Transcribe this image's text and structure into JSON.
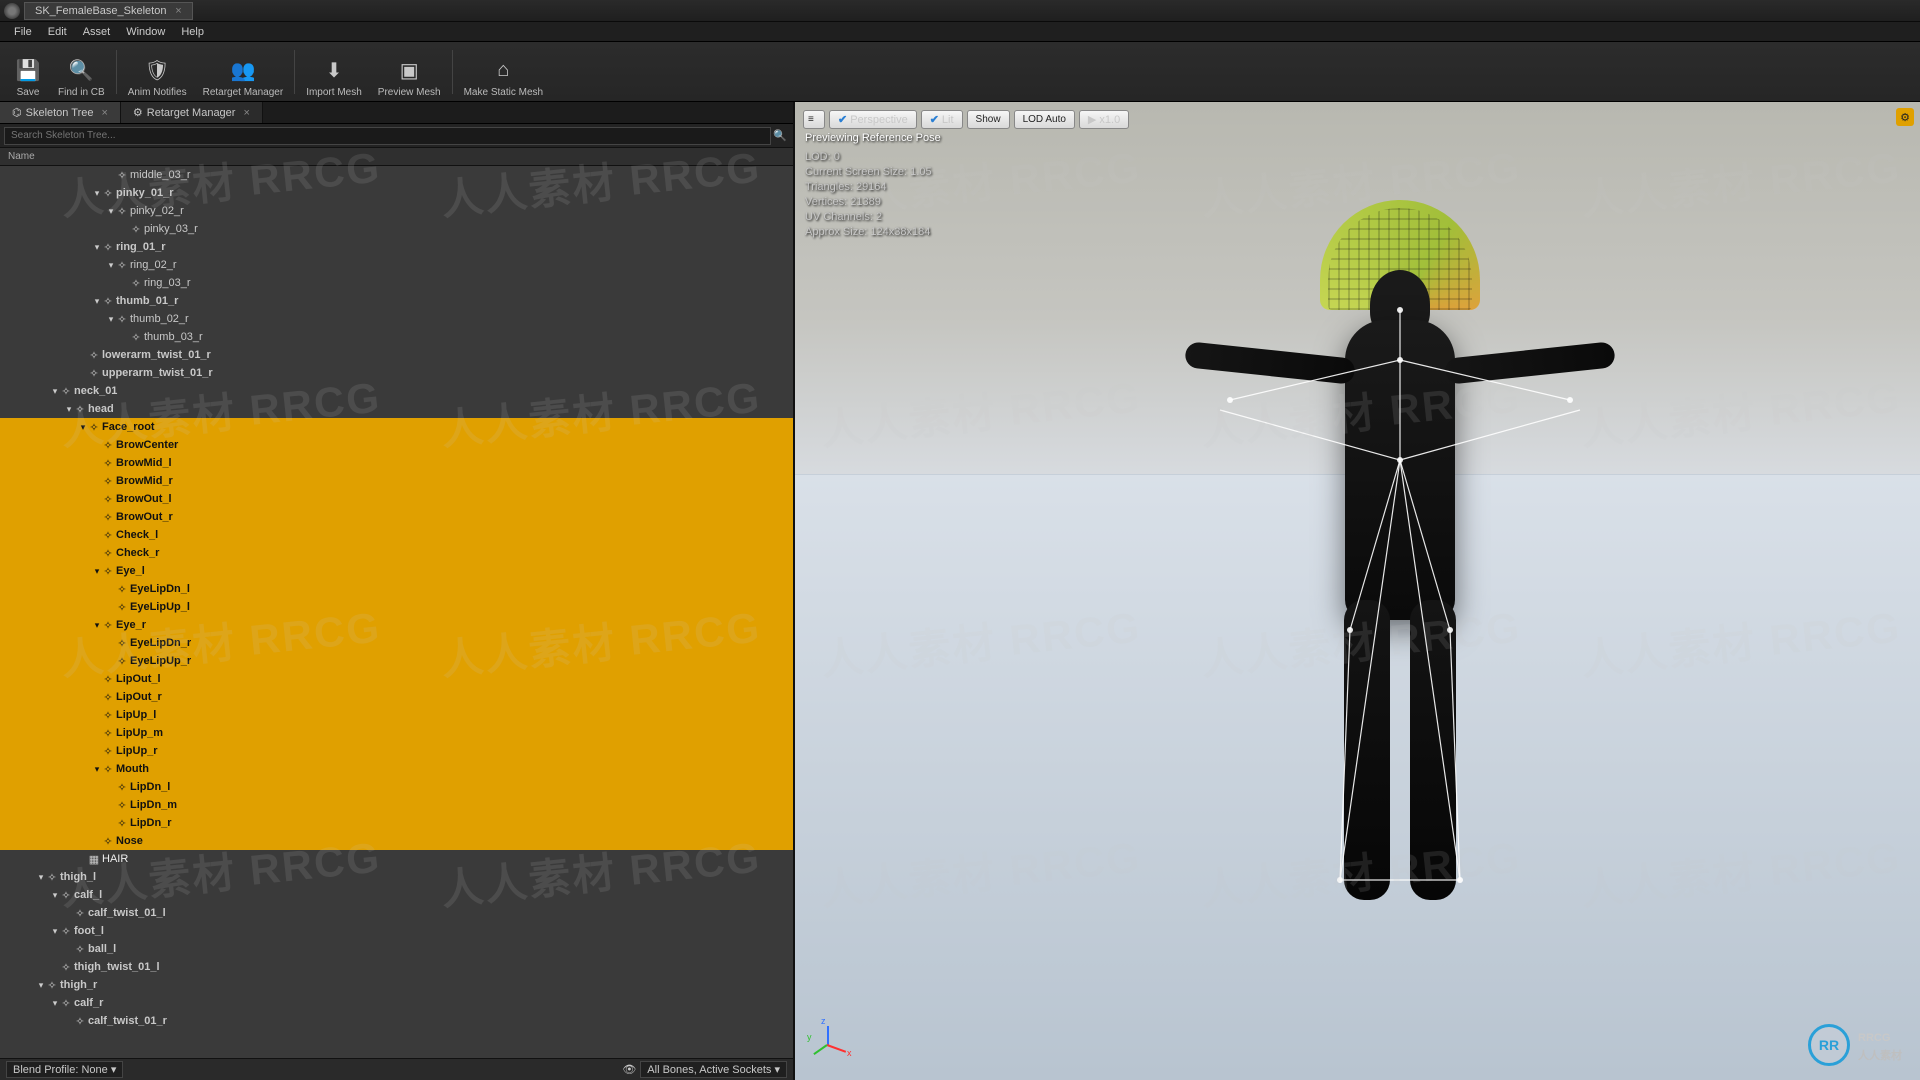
{
  "title_tab": "SK_FemaleBase_Skeleton",
  "menu": [
    "File",
    "Edit",
    "Asset",
    "Window",
    "Help"
  ],
  "toolbar": [
    {
      "icon": "💾",
      "label": "Save"
    },
    {
      "icon": "🔍",
      "label": "Find in CB"
    },
    {
      "sep": true
    },
    {
      "icon": "🛡",
      "label": "Anim Notifies"
    },
    {
      "icon": "👥",
      "label": "Retarget Manager"
    },
    {
      "sep": true
    },
    {
      "icon": "⬇",
      "label": "Import Mesh"
    },
    {
      "icon": "▣",
      "label": "Preview Mesh"
    },
    {
      "sep": true
    },
    {
      "icon": "⌂",
      "label": "Make Static Mesh"
    }
  ],
  "panel_tabs": [
    {
      "icon": "⌬",
      "label": "Skeleton Tree",
      "active": true
    },
    {
      "icon": "⚙",
      "label": "Retarget Manager",
      "active": false
    }
  ],
  "search_placeholder": "Search Skeleton Tree...",
  "col_header": "Name",
  "tree": [
    {
      "d": 7,
      "n": "middle_03_r",
      "a": ""
    },
    {
      "d": 6,
      "n": "pinky_01_r",
      "a": "▾",
      "bold": true
    },
    {
      "d": 7,
      "n": "pinky_02_r",
      "a": "▾"
    },
    {
      "d": 8,
      "n": "pinky_03_r",
      "a": ""
    },
    {
      "d": 6,
      "n": "ring_01_r",
      "a": "▾",
      "bold": true
    },
    {
      "d": 7,
      "n": "ring_02_r",
      "a": "▾"
    },
    {
      "d": 8,
      "n": "ring_03_r",
      "a": ""
    },
    {
      "d": 6,
      "n": "thumb_01_r",
      "a": "▾",
      "bold": true
    },
    {
      "d": 7,
      "n": "thumb_02_r",
      "a": "▾"
    },
    {
      "d": 8,
      "n": "thumb_03_r",
      "a": ""
    },
    {
      "d": 5,
      "n": "lowerarm_twist_01_r",
      "a": "",
      "bold": true
    },
    {
      "d": 5,
      "n": "upperarm_twist_01_r",
      "a": "",
      "bold": true
    },
    {
      "d": 3,
      "n": "neck_01",
      "a": "▾",
      "bold": true
    },
    {
      "d": 4,
      "n": "head",
      "a": "▾",
      "bold": true
    },
    {
      "d": 5,
      "n": "Face_root",
      "a": "▾",
      "sel": true,
      "bold": true
    },
    {
      "d": 6,
      "n": "BrowCenter",
      "a": "",
      "sel": true,
      "bold": true
    },
    {
      "d": 6,
      "n": "BrowMid_l",
      "a": "",
      "sel": true,
      "bold": true
    },
    {
      "d": 6,
      "n": "BrowMid_r",
      "a": "",
      "sel": true,
      "bold": true
    },
    {
      "d": 6,
      "n": "BrowOut_l",
      "a": "",
      "sel": true,
      "bold": true
    },
    {
      "d": 6,
      "n": "BrowOut_r",
      "a": "",
      "sel": true,
      "bold": true
    },
    {
      "d": 6,
      "n": "Check_l",
      "a": "",
      "sel": true,
      "bold": true
    },
    {
      "d": 6,
      "n": "Check_r",
      "a": "",
      "sel": true,
      "bold": true
    },
    {
      "d": 6,
      "n": "Eye_l",
      "a": "▾",
      "sel": true,
      "bold": true
    },
    {
      "d": 7,
      "n": "EyeLipDn_l",
      "a": "",
      "sel": true,
      "bold": true
    },
    {
      "d": 7,
      "n": "EyeLipUp_l",
      "a": "",
      "sel": true,
      "bold": true
    },
    {
      "d": 6,
      "n": "Eye_r",
      "a": "▾",
      "sel": true,
      "bold": true
    },
    {
      "d": 7,
      "n": "EyeLipDn_r",
      "a": "",
      "sel": true,
      "bold": true
    },
    {
      "d": 7,
      "n": "EyeLipUp_r",
      "a": "",
      "sel": true,
      "bold": true
    },
    {
      "d": 6,
      "n": "LipOut_l",
      "a": "",
      "sel": true,
      "bold": true
    },
    {
      "d": 6,
      "n": "LipOut_r",
      "a": "",
      "sel": true,
      "bold": true
    },
    {
      "d": 6,
      "n": "LipUp_l",
      "a": "",
      "sel": true,
      "bold": true
    },
    {
      "d": 6,
      "n": "LipUp_m",
      "a": "",
      "sel": true,
      "bold": true
    },
    {
      "d": 6,
      "n": "LipUp_r",
      "a": "",
      "sel": true,
      "bold": true
    },
    {
      "d": 6,
      "n": "Mouth",
      "a": "▾",
      "sel": true,
      "bold": true
    },
    {
      "d": 7,
      "n": "LipDn_l",
      "a": "",
      "sel": true,
      "bold": true
    },
    {
      "d": 7,
      "n": "LipDn_m",
      "a": "",
      "sel": true,
      "bold": true
    },
    {
      "d": 7,
      "n": "LipDn_r",
      "a": "",
      "sel": true,
      "bold": true
    },
    {
      "d": 6,
      "n": "Nose",
      "a": "",
      "sel": true,
      "bold": true
    },
    {
      "d": 5,
      "n": "HAIR",
      "a": "",
      "hair": true,
      "icon": "▦"
    },
    {
      "d": 2,
      "n": "thigh_l",
      "a": "▾",
      "bold": true
    },
    {
      "d": 3,
      "n": "calf_l",
      "a": "▾",
      "bold": true
    },
    {
      "d": 4,
      "n": "calf_twist_01_l",
      "a": "",
      "bold": true
    },
    {
      "d": 3,
      "n": "foot_l",
      "a": "▾",
      "bold": true
    },
    {
      "d": 4,
      "n": "ball_l",
      "a": "",
      "bold": true
    },
    {
      "d": 3,
      "n": "thigh_twist_01_l",
      "a": "",
      "bold": true
    },
    {
      "d": 2,
      "n": "thigh_r",
      "a": "▾",
      "bold": true
    },
    {
      "d": 3,
      "n": "calf_r",
      "a": "▾",
      "bold": true
    },
    {
      "d": 4,
      "n": "calf_twist_01_r",
      "a": "",
      "bold": true
    }
  ],
  "left_status": {
    "blend": "Blend Profile: None ▾",
    "filter_icon": "👁",
    "filter": "All Bones, Active Sockets ▾"
  },
  "viewport": {
    "buttons": {
      "menu": "≡",
      "perspective": "Perspective",
      "lit": "Lit",
      "show": "Show",
      "lod": "LOD Auto",
      "speed": "x1.0"
    },
    "caption": "Previewing Reference Pose",
    "stats": [
      "LOD: 0",
      "Current Screen Size: 1.05",
      "Triangles: 29164",
      "Vertices: 21389",
      "UV Channels: 2",
      "Approx Size: 124x38x184"
    ],
    "axis": {
      "x": "x",
      "y": "y",
      "z": "z"
    }
  },
  "watermark": "人人素材 RRCG",
  "rrcg": {
    "logo": "RR",
    "big": "RRCG",
    "small": "人人素材"
  }
}
